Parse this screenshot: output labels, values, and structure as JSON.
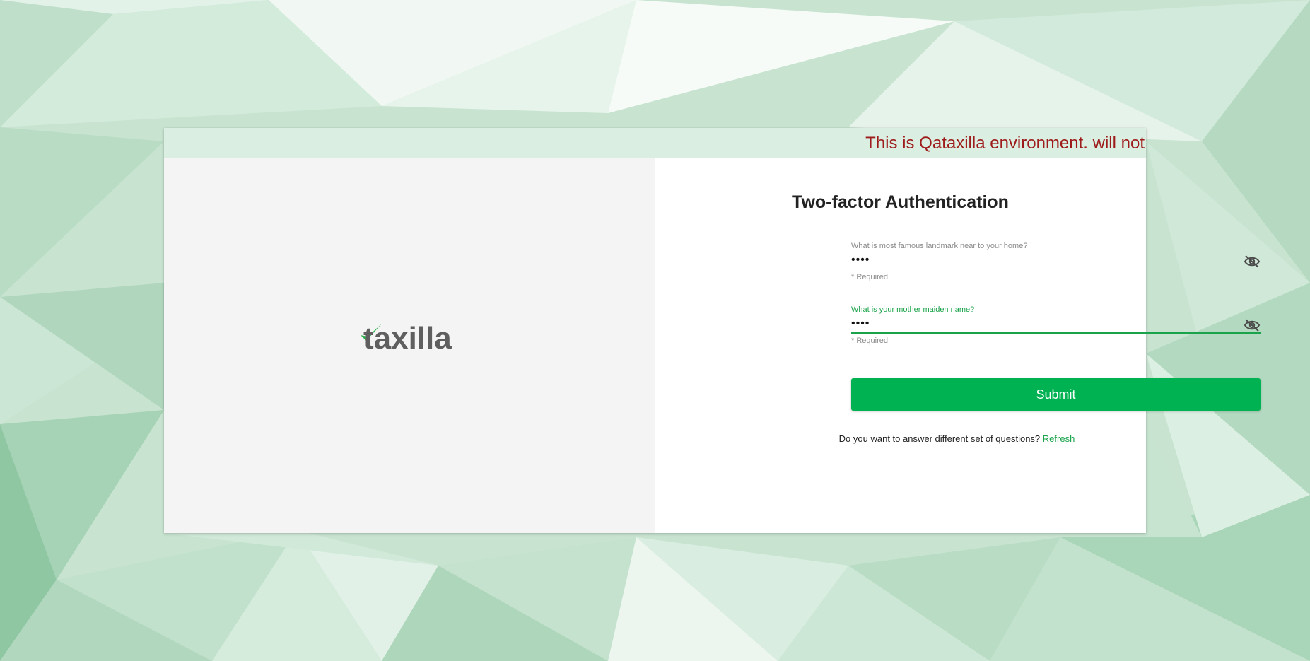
{
  "banner": {
    "text": "This is Qataxilla environment. will not"
  },
  "logo": {
    "text": "taxilla"
  },
  "form": {
    "title": "Two-factor Authentication",
    "fields": [
      {
        "label": "What is most famous landmark near to your home?",
        "value": "••••",
        "help": "* Required",
        "toggle_icon": "eye-off-icon"
      },
      {
        "label": "What is your mother maiden name?",
        "value": "••••",
        "help": "* Required",
        "toggle_icon": "eye-off-icon"
      }
    ],
    "submit_label": "Submit",
    "refresh_prompt": "Do you want to answer different set of questions?",
    "refresh_label": "Refresh"
  },
  "colors": {
    "accent": "#00b251",
    "banner_text": "#9e1b1b",
    "banner_bg": "#dbeee2"
  }
}
